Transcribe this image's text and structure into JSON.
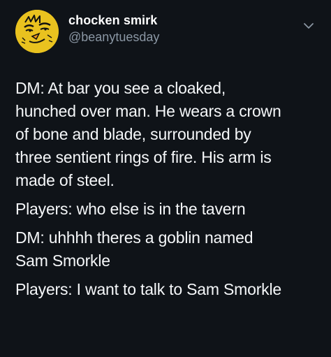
{
  "tweet": {
    "author": {
      "display_name": "chocken smirk",
      "handle": "@beanytuesday",
      "avatar_icon": "smirking-chicken-avatar",
      "avatar_color": "#e9c21f"
    },
    "menu_icon": "chevron-down-icon",
    "paragraphs": [
      {
        "lines": [
          "DM: At bar you see a cloaked,",
          "hunched over man. He wears a crown",
          "of bone and blade, surrounded by",
          "three sentient rings of fire. His arm is",
          "made of steel."
        ]
      },
      {
        "lines": [
          "Players: who else is in the tavern"
        ]
      },
      {
        "lines": [
          "DM: uhhhh theres a goblin named",
          "Sam Smorkle"
        ]
      },
      {
        "lines": [
          "Players: I want to talk to Sam Smorkle"
        ]
      }
    ]
  },
  "colors": {
    "background": "#0f1318",
    "text": "#f5f7f9",
    "secondary_text": "#8a96a3"
  }
}
